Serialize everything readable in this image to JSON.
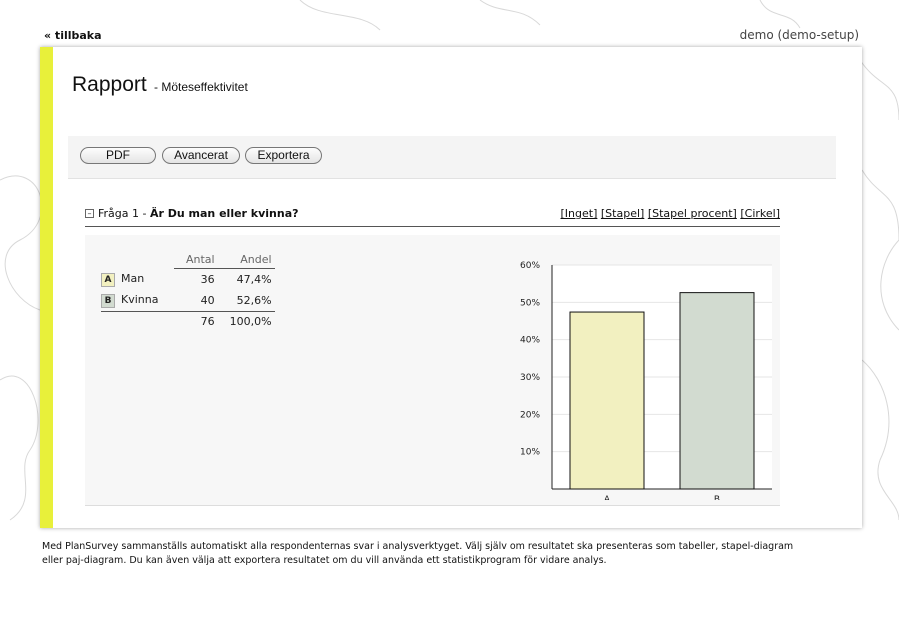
{
  "nav": {
    "back_label": "« tillbaka",
    "user": "demo (demo-setup)"
  },
  "report": {
    "title": "Rapport",
    "subtitle": "- Möteseffektivitet"
  },
  "toolbar": {
    "pdf": "PDF",
    "advanced": "Avancerat",
    "export": "Exportera"
  },
  "question": {
    "collapse_symbol": "–",
    "prefix": "Fråga 1 - ",
    "text": "Är Du man eller kvinna?",
    "views": [
      "[Inget]",
      "[Stapel]",
      "[Stapel procent]",
      "[Cirkel]"
    ]
  },
  "stats": {
    "headers": {
      "antal": "Antal",
      "andel": "Andel"
    },
    "rows": [
      {
        "code": "A",
        "label": "Man",
        "count": "36",
        "share": "47,4%",
        "color": "#f2f0c0"
      },
      {
        "code": "B",
        "label": "Kvinna",
        "count": "40",
        "share": "52,6%",
        "color": "#d2dbd0"
      }
    ],
    "total": {
      "count": "76",
      "share": "100,0%"
    }
  },
  "chart_data": {
    "type": "bar",
    "categories": [
      "A",
      "B"
    ],
    "values": [
      47.4,
      52.6
    ],
    "colors": [
      "#f2f0c0",
      "#d2dbd0"
    ],
    "ylim": [
      0,
      60
    ],
    "yticks": [
      "10%",
      "20%",
      "30%",
      "40%",
      "50%",
      "60%"
    ],
    "grid": true
  },
  "footer": "Med PlanSurvey sammanställs automatiskt alla respondenternas svar i analysverktyget. Välj själv om resultatet ska presenteras som tabeller, stapel-diagram eller paj-diagram. Du kan även välja att exportera resultatet om du vill använda ett statistikprogram för vidare analys."
}
